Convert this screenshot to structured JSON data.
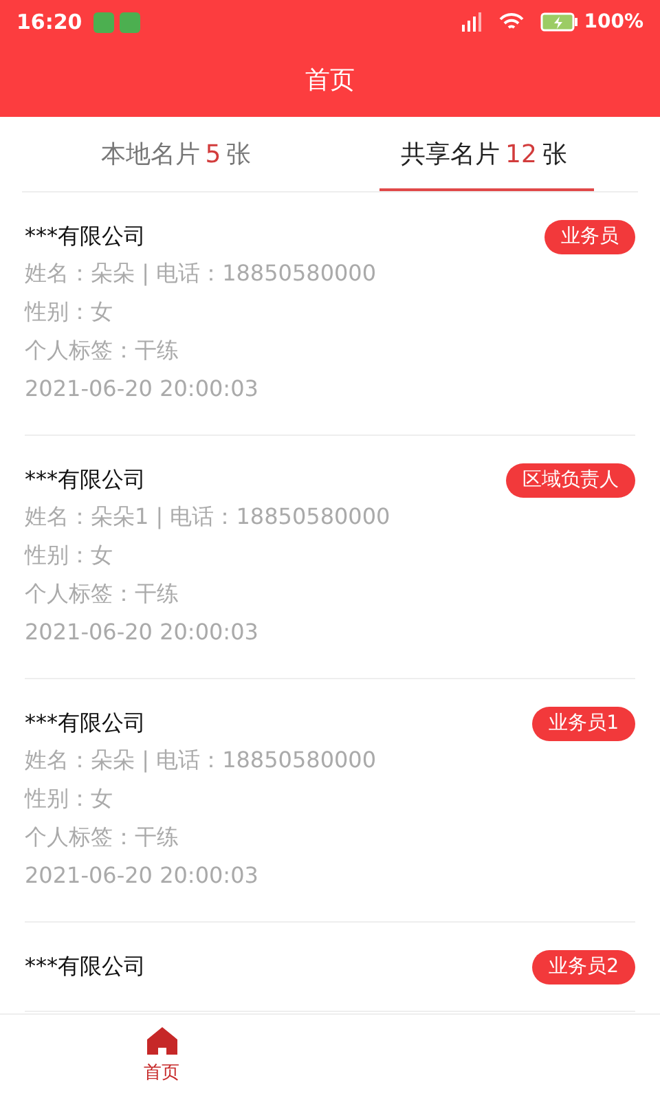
{
  "status_bar": {
    "time": "16:20",
    "battery": "100%"
  },
  "header": {
    "title": "首页"
  },
  "tabs": [
    {
      "label": "本地名片",
      "count": "5",
      "unit": "张",
      "selected": false
    },
    {
      "label": "共享名片",
      "count": "12",
      "unit": "张",
      "selected": true
    }
  ],
  "cards": [
    {
      "company": "***有限公司",
      "role": "业务员",
      "lines": [
        "姓名：朵朵 | 电话：18850580000",
        "性别：女",
        "个人标签：干练",
        "2021-06-20 20:00:03"
      ]
    },
    {
      "company": "***有限公司",
      "role": "区域负责人",
      "lines": [
        "姓名：朵朵1 | 电话：18850580000",
        "性别：女",
        "个人标签：干练",
        "2021-06-20 20:00:03"
      ]
    },
    {
      "company": "***有限公司",
      "role": "业务员1",
      "lines": [
        "姓名：朵朵 | 电话：18850580000",
        "性别：女",
        "个人标签：干练",
        "2021-06-20 20:00:03"
      ]
    },
    {
      "company": "***有限公司",
      "role": "业务员2"
    }
  ],
  "bottom_nav": [
    {
      "label": "首页",
      "selected": true
    }
  ]
}
